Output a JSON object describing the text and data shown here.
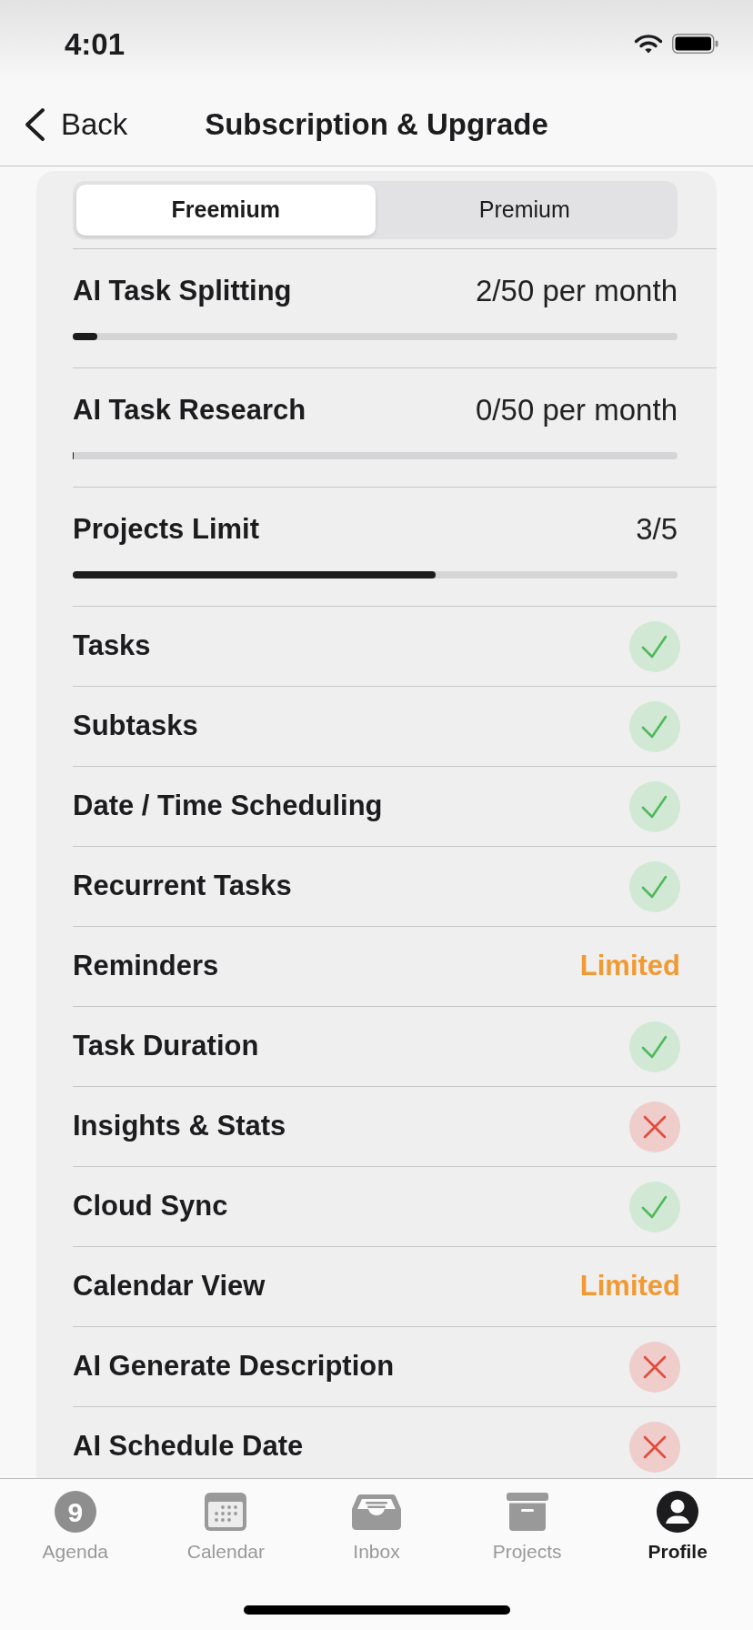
{
  "status_bar": {
    "time": "4:01"
  },
  "nav_bar": {
    "back_label": "Back",
    "title": "Subscription & Upgrade"
  },
  "plan_tabs": [
    {
      "label": "Freemium",
      "selected": true
    },
    {
      "label": "Premium",
      "selected": false
    }
  ],
  "usage_limits": [
    {
      "name": "AI Task Splitting",
      "reading": "2/50 per month",
      "level": 0.04
    },
    {
      "name": "AI Task Research",
      "reading": "0/50 per month",
      "level": 0
    },
    {
      "name": "Projects Limit",
      "reading": "3/5",
      "level": 0.6
    }
  ],
  "features": [
    {
      "name": "Tasks",
      "kind": "included"
    },
    {
      "name": "Subtasks",
      "kind": "included"
    },
    {
      "name": "Date / Time Scheduling",
      "kind": "included"
    },
    {
      "name": "Recurrent Tasks",
      "kind": "included"
    },
    {
      "name": "Reminders",
      "kind": "limited",
      "value": "Limited"
    },
    {
      "name": "Task Duration",
      "kind": "included"
    },
    {
      "name": "Insights & Stats",
      "kind": "excluded"
    },
    {
      "name": "Cloud Sync",
      "kind": "included"
    },
    {
      "name": "Calendar View",
      "kind": "limited",
      "value": "Limited"
    },
    {
      "name": "AI Generate Description",
      "kind": "excluded"
    },
    {
      "name": "AI Schedule Date",
      "kind": "excluded"
    }
  ],
  "tab_bar": [
    {
      "label": "Agenda",
      "selected": false,
      "badge": "9"
    },
    {
      "label": "Calendar",
      "selected": false
    },
    {
      "label": "Inbox",
      "selected": false
    },
    {
      "label": "Projects",
      "selected": false
    },
    {
      "label": "Profile",
      "selected": true
    }
  ]
}
